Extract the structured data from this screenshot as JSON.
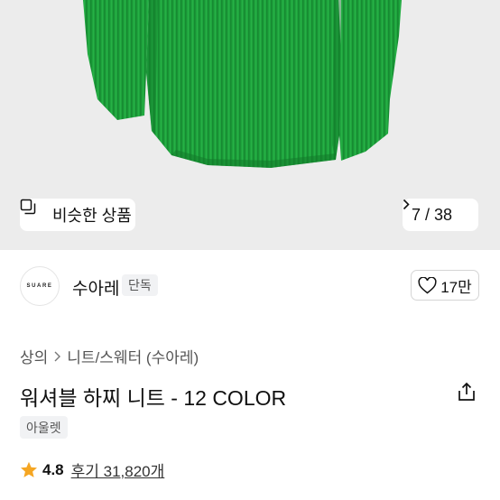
{
  "gallery": {
    "similar_label": "비슷한 상품",
    "counter": "7 / 38",
    "image_colors": {
      "background": "#ececec",
      "garment": "#1ea43d"
    }
  },
  "brand": {
    "logo_text": "SUARE",
    "name": "수아레",
    "badge": "단독",
    "like_count": "17만"
  },
  "product": {
    "breadcrumb": [
      "상의",
      "니트/스웨터 (수아레)"
    ],
    "title": "워셔블 하찌 니트 - 12 COLOR",
    "tag": "아울렛",
    "rating": "4.8",
    "reviews": "후기 31,820개"
  },
  "colors": {
    "accent_star": "#f5a623"
  }
}
